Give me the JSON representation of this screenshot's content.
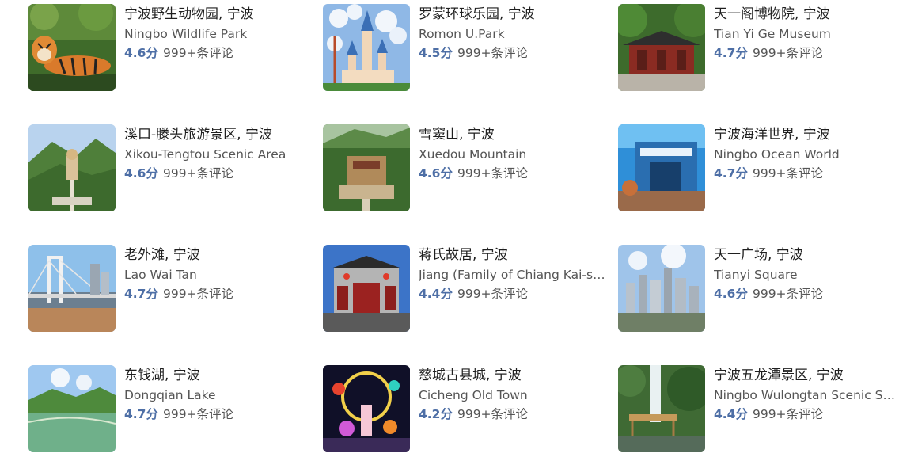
{
  "attractions": [
    {
      "name_cn": "宁波野生动物园, 宁波",
      "name_en": "Ningbo Wildlife Park",
      "score": "4.6分",
      "reviews": "999+条评论",
      "thumbnail": "tiger"
    },
    {
      "name_cn": "罗蒙环球乐园, 宁波",
      "name_en": "Romon U.Park",
      "score": "4.5分",
      "reviews": "999+条评论",
      "thumbnail": "castle"
    },
    {
      "name_cn": "天一阁博物院, 宁波",
      "name_en": "Tian Yi Ge Museum",
      "score": "4.7分",
      "reviews": "999+条评论",
      "thumbnail": "pavilion"
    },
    {
      "name_cn": "溪口-滕头旅游景区, 宁波",
      "name_en": "Xikou-Tengtou Scenic Area",
      "score": "4.6分",
      "reviews": "999+条评论",
      "thumbnail": "mountain-buddha"
    },
    {
      "name_cn": "雪窦山, 宁波",
      "name_en": "Xuedou Mountain",
      "score": "4.6分",
      "reviews": "999+条评论",
      "thumbnail": "temple-aerial"
    },
    {
      "name_cn": "宁波海洋世界, 宁波",
      "name_en": "Ningbo Ocean World",
      "score": "4.7分",
      "reviews": "999+条评论",
      "thumbnail": "aquarium"
    },
    {
      "name_cn": "老外滩, 宁波",
      "name_en": "Lao Wai Tan",
      "score": "4.7分",
      "reviews": "999+条评论",
      "thumbnail": "bridge"
    },
    {
      "name_cn": "蒋氏故居, 宁波",
      "name_en": "Jiang (Family of Chiang Kai-shek) Former Residence",
      "score": "4.4分",
      "reviews": "999+条评论",
      "thumbnail": "gate"
    },
    {
      "name_cn": "天一广场, 宁波",
      "name_en": "Tianyi Square",
      "score": "4.6分",
      "reviews": "999+条评论",
      "thumbnail": "city"
    },
    {
      "name_cn": "东钱湖, 宁波",
      "name_en": "Dongqian Lake",
      "score": "4.7分",
      "reviews": "999+条评论",
      "thumbnail": "lake"
    },
    {
      "name_cn": "慈城古县城, 宁波",
      "name_en": "Cicheng Old Town",
      "score": "4.2分",
      "reviews": "999+条评论",
      "thumbnail": "night-lights"
    },
    {
      "name_cn": "宁波五龙潭景区, 宁波",
      "name_en": "Ningbo Wulongtan Scenic Spot",
      "score": "4.4分",
      "reviews": "999+条评论",
      "thumbnail": "waterfall"
    }
  ]
}
